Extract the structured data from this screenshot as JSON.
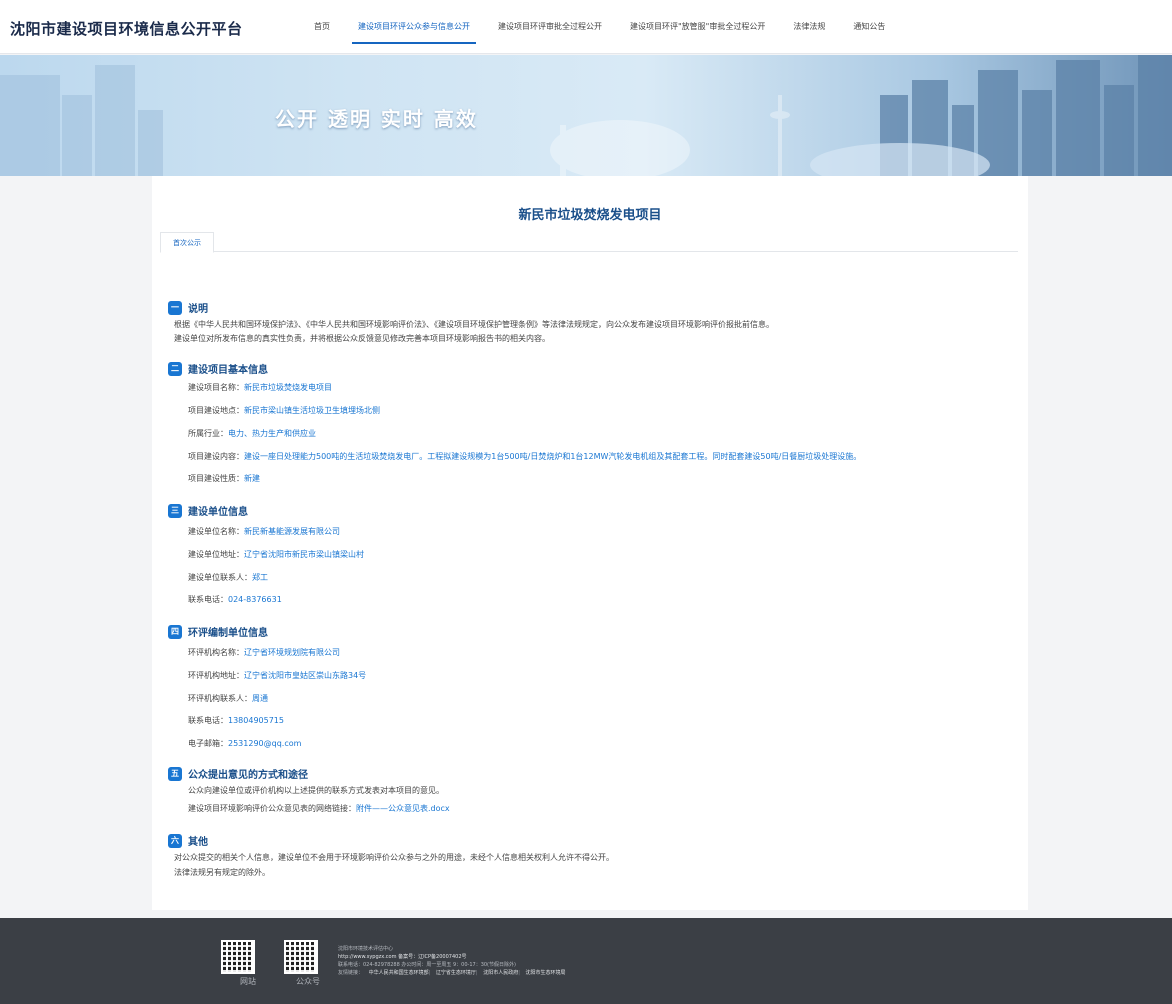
{
  "header": {
    "site_title": "沈阳市建设项目环境信息公开平台",
    "nav": [
      "首页",
      "建设项目环评公众参与信息公开",
      "建设项目环评审批全过程公开",
      "建设项目环评\"放管服\"审批全过程公开",
      "法律法规",
      "通知公告"
    ],
    "active_index": 1
  },
  "banner": {
    "slogan": "公开 透明 实时 高效"
  },
  "project": {
    "title": "新民市垃圾焚烧发电项目",
    "tab": "首次公示"
  },
  "sections": {
    "s1": {
      "num": "一",
      "title": "说明",
      "line1": "根据《中华人民共和国环境保护法》、《中华人民共和国环境影响评价法》、《建设项目环境保护管理条例》等法律法规规定，向公众发布建设项目环境影响评价报批前信息。",
      "line2": "建设单位对所发布信息的真实性负责，并将根据公众反馈意见修改完善本项目环境影响报告书的相关内容。"
    },
    "s2": {
      "num": "二",
      "title": "建设项目基本信息",
      "rows": [
        {
          "label": "建设项目名称：",
          "value": "新民市垃圾焚烧发电项目"
        },
        {
          "label": "项目建设地点：",
          "value": "新民市梁山镇生活垃圾卫生填埋场北侧"
        },
        {
          "label": "所属行业：",
          "value": "电力、热力生产和供应业"
        },
        {
          "label": "项目建设内容：",
          "value": "建设一座日处理能力500吨的生活垃圾焚烧发电厂。工程拟建设规模为1台500吨/日焚烧炉和1台12MW汽轮发电机组及其配套工程。同时配套建设50吨/日餐厨垃圾处理设施。"
        },
        {
          "label": "项目建设性质：",
          "value": "新建"
        }
      ]
    },
    "s3": {
      "num": "三",
      "title": "建设单位信息",
      "rows": [
        {
          "label": "建设单位名称：",
          "value": "新民新基能源发展有限公司"
        },
        {
          "label": "建设单位地址：",
          "value": "辽宁省沈阳市新民市梁山镇梁山村"
        },
        {
          "label": "建设单位联系人：",
          "value": "郑工"
        },
        {
          "label": "联系电话：",
          "value": "024-8376631"
        }
      ]
    },
    "s4": {
      "num": "四",
      "title": "环评编制单位信息",
      "rows": [
        {
          "label": "环评机构名称：",
          "value": "辽宁省环境规划院有限公司"
        },
        {
          "label": "环评机构地址：",
          "value": "辽宁省沈阳市皇姑区崇山东路34号"
        },
        {
          "label": "环评机构联系人：",
          "value": "周通"
        },
        {
          "label": "联系电话：",
          "value": "13804905715"
        },
        {
          "label": "电子邮箱：",
          "value": "2531290@qq.com"
        }
      ]
    },
    "s5": {
      "num": "五",
      "title": "公众提出意见的方式和途径",
      "line1": "公众向建设单位或评价机构以上述提供的联系方式发表对本项目的意见。",
      "line2_label": "建设项目环境影响评价公众意见表的网络链接：",
      "line2_link": "附件——公众意见表.docx"
    },
    "s6": {
      "num": "六",
      "title": "其他",
      "line1": "对公众提交的相关个人信息，建设单位不会用于环境影响评价公众参与之外的用途，未经个人信息相关权利人允许不得公开。",
      "line2": "法律法规另有规定的除外。"
    }
  },
  "footer": {
    "qr1_label": "网站",
    "qr2_label": "公众号",
    "org": "沈阳市环境技术评估中心",
    "url_line": "http://www.sypgzx.com 备案号：辽ICP备20007402号",
    "contact_line": "联系电话：024-82978288 办公时间：周一至周五 9：00-17：30(节假日除外)",
    "links_label": "友情链接：",
    "links": [
      "中华人民共和国生态环境部",
      "辽宁省生态环境厅",
      "沈阳市人民政府",
      "沈阳市生态环境局"
    ]
  },
  "colors": {
    "accent": "#1976d2",
    "title": "#1a4f8a",
    "footer_bg": "#3b3f45"
  }
}
